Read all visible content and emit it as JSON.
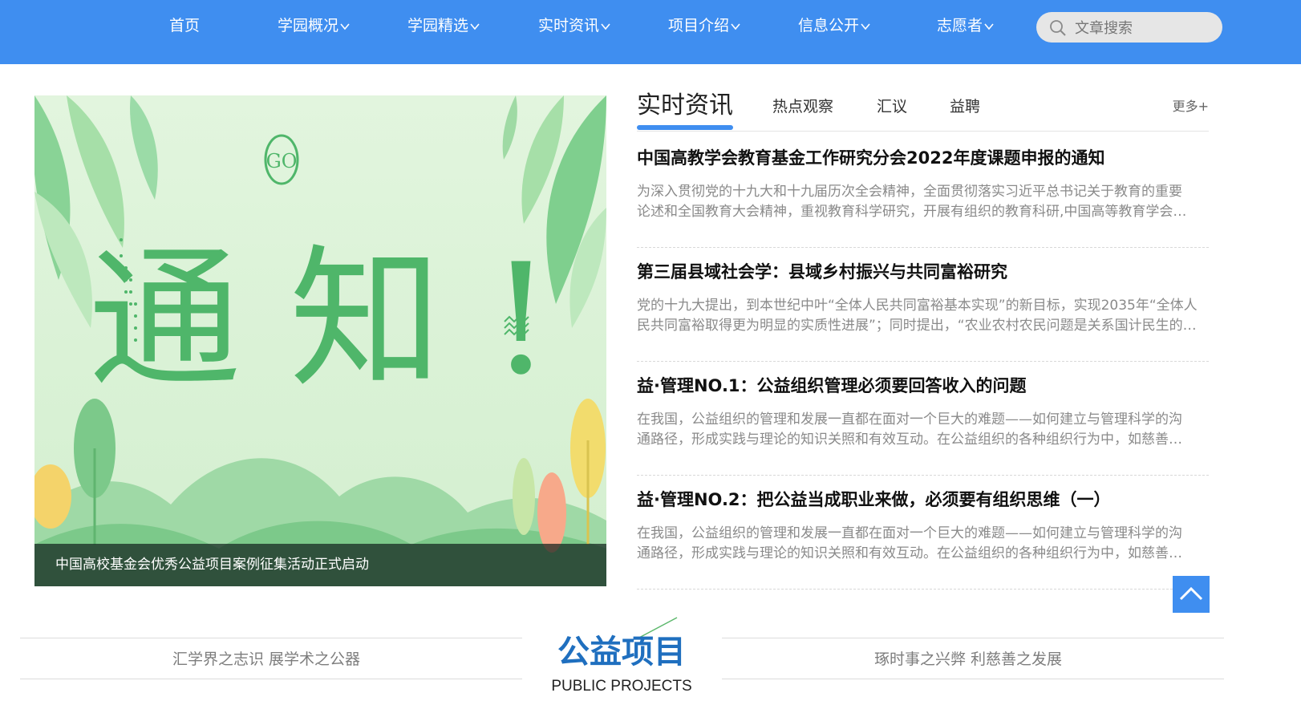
{
  "nav": {
    "items": [
      {
        "label": "首页",
        "has_dropdown": false
      },
      {
        "label": "学园概况",
        "has_dropdown": true
      },
      {
        "label": "学园精选",
        "has_dropdown": true
      },
      {
        "label": "实时资讯",
        "has_dropdown": true
      },
      {
        "label": "项目介绍",
        "has_dropdown": true
      },
      {
        "label": "信息公开",
        "has_dropdown": true
      },
      {
        "label": "志愿者",
        "has_dropdown": true
      }
    ],
    "search": {
      "placeholder": "文章搜索",
      "value": ""
    }
  },
  "banner": {
    "badge": "GO",
    "headline": "通 知 !",
    "caption": "中国高校基金会优秀公益项目案例征集活动正式启动"
  },
  "news": {
    "active_tab": "实时资讯",
    "tabs": [
      "热点观察",
      "汇议",
      "益聘"
    ],
    "more": "更多+",
    "items": [
      {
        "title": "中国高教学会教育基金工作研究分会2022年度课题申报的通知",
        "summary_line1": "为深入贯彻党的十九大和十九届历次全会精神，全面贯彻落实习近平总书记关于教育的重要",
        "summary_line2": "论述和全国教育大会精神，重视教育科学研究，开展有组织的教育科研,中国高等教育学会…"
      },
      {
        "title": "第三届县域社会学：县域乡村振兴与共同富裕研究",
        "summary_line1": "党的十九大提出，到本世纪中叶“全体人民共同富裕基本实现”的新目标，实现2035年“全体人",
        "summary_line2": "民共同富裕取得更为明显的实质性进展”；同时提出，“农业农村农民问题是关系国计民生的…"
      },
      {
        "title": "益·管理NO.1：公益组织管理必须要回答收入的问题",
        "summary_line1": "在我国，公益组织的管理和发展一直都在面对一个巨大的难题——如何建立与管理科学的沟",
        "summary_line2": "通路径，形成实践与理论的知识关照和有效互动。在公益组织的各种组织行为中，如慈善…"
      },
      {
        "title": "益·管理NO.2：把公益当成职业来做，必须要有组织思维（一）",
        "summary_line1": "在我国，公益组织的管理和发展一直都在面对一个巨大的难题——如何建立与管理科学的沟",
        "summary_line2": "通路径，形成实践与理论的知识关照和有效互动。在公益组织的各种组织行为中，如慈善…"
      }
    ]
  },
  "section": {
    "slogan_left": "汇学界之志识 展学术之公器",
    "title": "公益项目",
    "subtitle": "PUBLIC PROJECTS",
    "slogan_right": "琢时事之兴弊 利慈善之发展"
  },
  "colors": {
    "nav_bg": "#3f8ef0",
    "accent": "#3f8ef0",
    "section_title": "#1f6fbf"
  }
}
